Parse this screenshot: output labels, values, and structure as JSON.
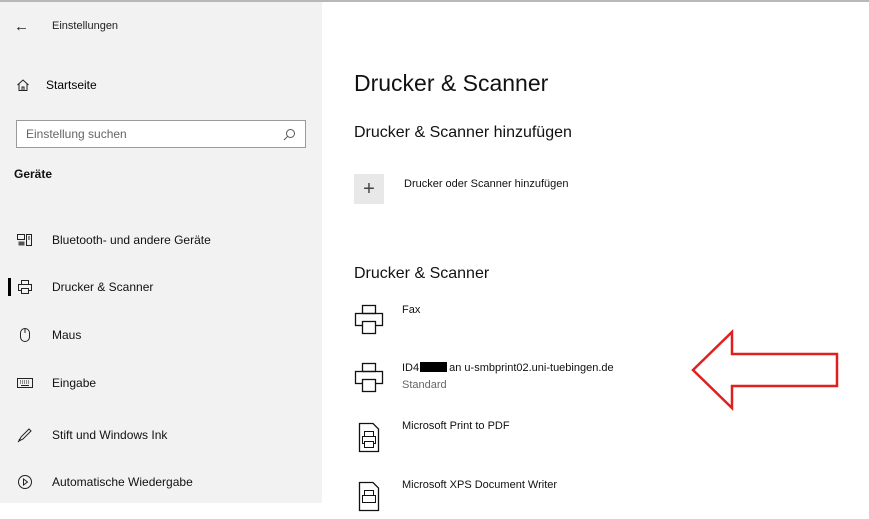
{
  "window": {
    "back_glyph": "←",
    "title": "Einstellungen"
  },
  "sidebar": {
    "home_label": "Startseite",
    "search": {
      "placeholder": "Einstellung suchen",
      "value": ""
    },
    "section_label": "Geräte",
    "items": [
      {
        "label": "Bluetooth- und andere Geräte",
        "icon": "bluetooth-devices-icon"
      },
      {
        "label": "Drucker & Scanner",
        "icon": "printer-icon",
        "active": true
      },
      {
        "label": "Maus",
        "icon": "mouse-icon"
      },
      {
        "label": "Eingabe",
        "icon": "keyboard-icon"
      },
      {
        "label": "Stift und Windows Ink",
        "icon": "pen-icon"
      },
      {
        "label": "Automatische Wiedergabe",
        "icon": "autoplay-icon"
      }
    ]
  },
  "main": {
    "page_title": "Drucker & Scanner",
    "add_section_heading": "Drucker & Scanner hinzufügen",
    "add_button_label": "Drucker oder Scanner hinzufügen",
    "list_heading": "Drucker & Scanner",
    "printers": [
      {
        "name": "Fax",
        "status": "",
        "icon": "printer-icon"
      },
      {
        "name_prefix": "ID4",
        "name_suffix": "an u-smbprint02.uni-tuebingen.de",
        "status": "Standard",
        "icon": "printer-icon",
        "redacted": true
      },
      {
        "name": "Microsoft Print to PDF",
        "status": "",
        "icon": "document-printer-icon"
      },
      {
        "name": "Microsoft XPS Document Writer",
        "status": "",
        "icon": "document-printer-icon"
      }
    ]
  },
  "annotation": {
    "type": "red-outline-arrow",
    "color": "#e02020",
    "points_to": "default printer"
  },
  "colors": {
    "sidebar_bg": "#f2f2f2",
    "main_bg": "#ffffff",
    "active_bar": "#000000",
    "arrow": "#e02020"
  }
}
